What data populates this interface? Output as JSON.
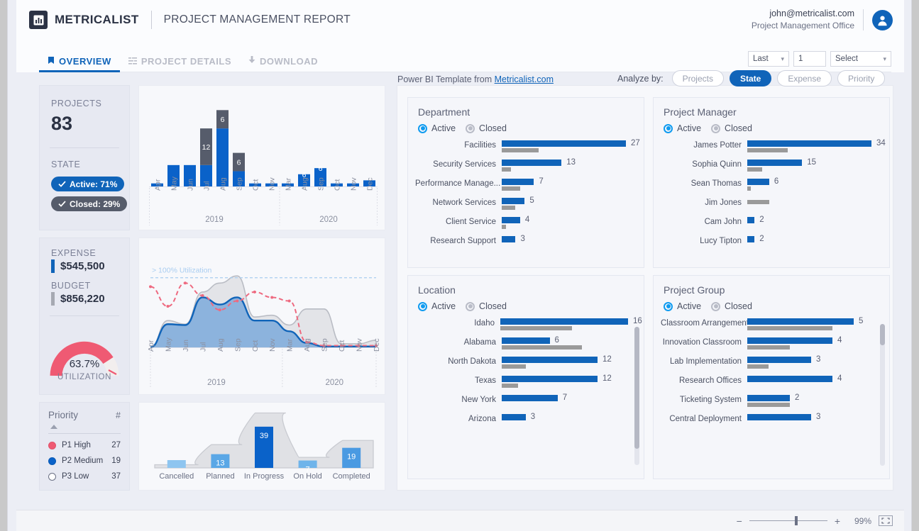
{
  "header": {
    "brand": "METRICALIST",
    "report_title": "PROJECT MANAGEMENT REPORT",
    "user_email": "john@metricalist.com",
    "user_org": "Project Management Office",
    "avatar_icon": "user-avatar-icon",
    "logo_icon": "bar-chart-logo-icon"
  },
  "tabs": [
    {
      "label": "OVERVIEW",
      "icon": "bookmark-icon",
      "active": true
    },
    {
      "label": "PROJECT DETAILS",
      "icon": "list-icon",
      "active": false
    },
    {
      "label": "DOWNLOAD",
      "icon": "download-arrow-icon",
      "active": false
    }
  ],
  "filters": {
    "range_value": "Last",
    "count_value": "1",
    "select_value": "Select",
    "chevron_icon": "chevron-down-icon"
  },
  "kpi": {
    "projects_label": "PROJECTS",
    "projects_value": "83",
    "state_label": "STATE",
    "state_active": "Active: 71%",
    "state_closed": "Closed: 29%",
    "check_icon": "check-icon",
    "expense_label": "EXPENSE",
    "expense_value": "$545,500",
    "budget_label": "BUDGET",
    "budget_value": "$856,220",
    "gauge_value": "63.7%",
    "gauge_label": "UTILIZATION",
    "gauge_percent": 63.7
  },
  "priority": {
    "col_label": "Priority",
    "col_count": "#",
    "sort_icon": "sort-ascending-icon",
    "rows": [
      {
        "label": "P1 High",
        "count": "27",
        "color": "#ef5a73"
      },
      {
        "label": "P2 Medium",
        "count": "19",
        "color": "#0a62c9"
      },
      {
        "label": "P3 Low",
        "count": "37",
        "color": "#ffffff"
      }
    ]
  },
  "toolbar": {
    "pbi_prefix": "Power BI Template from ",
    "pbi_link": "Metricalist.com",
    "analyze_label": "Analyze by:",
    "chips": [
      {
        "label": "Projects",
        "on": false
      },
      {
        "label": "State",
        "on": true
      },
      {
        "label": "Expense",
        "on": false
      },
      {
        "label": "Priority",
        "on": false
      }
    ]
  },
  "colors": {
    "accent_blue": "#1064b9",
    "closed_gray": "#565c6b",
    "bar_gray": "#9a9a9a",
    "gauge_red": "#ef5a73",
    "light_blue": "#8ec5f0"
  },
  "chart_data": [
    {
      "type": "bar",
      "id": "timeline-bar-chart",
      "title": "",
      "xlabel": "",
      "ylabel": "",
      "stacked": true,
      "categories": [
        "Apr",
        "May",
        "Jun",
        "Jul",
        "Aug",
        "Sep",
        "Oct",
        "Nov",
        "Mar",
        "Aug",
        "Sep",
        "Oct",
        "Nov",
        "Dec"
      ],
      "group_labels": [
        "2019",
        "2020"
      ],
      "group_spans": [
        8,
        6
      ],
      "series": [
        {
          "name": "Active",
          "color": "#0a62c9",
          "values": [
            1,
            7,
            7,
            7,
            19,
            5,
            1,
            1,
            1,
            4,
            6,
            1,
            1,
            2
          ]
        },
        {
          "name": "Closed",
          "color": "#565c6b",
          "values": [
            0,
            0,
            0,
            12,
            6,
            6,
            0,
            0,
            0,
            0,
            0,
            0,
            0,
            0
          ]
        }
      ],
      "data_labels": [
        {
          "category": "Jul",
          "value": "12"
        },
        {
          "category": "Aug",
          "value": "6"
        },
        {
          "category": "Sep",
          "value": "6"
        }
      ],
      "ylim": [
        0,
        26
      ]
    },
    {
      "type": "area",
      "id": "utilization-area-chart",
      "title": "",
      "annotation": "> 100% Utilization",
      "categories": [
        "Apr",
        "May",
        "Jun",
        "Jul",
        "Aug",
        "Sep",
        "Oct",
        "Nov",
        "Mar",
        "Aug",
        "Sep",
        "Oct",
        "Nov",
        "Dec"
      ],
      "group_labels": [
        "2019",
        "2020"
      ],
      "group_spans": [
        8,
        6
      ],
      "series": [
        {
          "name": "Budget",
          "color": "#d7d9dd",
          "type": "area",
          "values": [
            0,
            30,
            26,
            62,
            72,
            80,
            34,
            36,
            25,
            43,
            43,
            4,
            4,
            8
          ]
        },
        {
          "name": "Expense",
          "color": "#6fa8dc",
          "type": "area",
          "values": [
            0,
            26,
            25,
            56,
            48,
            56,
            30,
            30,
            18,
            5,
            1,
            1,
            1,
            1
          ]
        },
        {
          "name": "Utilization",
          "color": "#ee6a80",
          "type": "dashed-line",
          "values": [
            68,
            46,
            72,
            58,
            42,
            52,
            62,
            56,
            52,
            6,
            2,
            2,
            2,
            2
          ]
        }
      ],
      "reference_line": {
        "label": "> 100% Utilization",
        "color": "#a9cdf0"
      },
      "ylim": [
        0,
        100
      ]
    },
    {
      "type": "bar",
      "id": "project-status-chart",
      "categories": [
        "Cancelled",
        "Planned",
        "In Progress",
        "On Hold",
        "Completed"
      ],
      "values": [
        0,
        13,
        39,
        7,
        19
      ],
      "labels": [
        "",
        "13",
        "39",
        "7",
        "19"
      ],
      "bar_colors": [
        "#8ec5f0",
        "#5aa7e6",
        "#0a62c9",
        "#6fb4ea",
        "#4a9ae2"
      ],
      "background_series": {
        "name": "envelope",
        "color": "#dddfe3",
        "values": [
          3,
          22,
          52,
          10,
          26
        ]
      },
      "ylim": [
        0,
        55
      ]
    },
    {
      "type": "bar",
      "id": "department-chart",
      "title": "Department",
      "orientation": "horizontal",
      "legend": [
        {
          "label": "Active",
          "on": true
        },
        {
          "label": "Closed",
          "on": false
        }
      ],
      "categories": [
        "Facilities",
        "Security Services",
        "Performance Manage...",
        "Network Services",
        "Client Service",
        "Research Support"
      ],
      "series": [
        {
          "name": "Active",
          "color": "#1064b9",
          "values": [
            27,
            13,
            7,
            5,
            4,
            3
          ]
        },
        {
          "name": "Closed",
          "color": "#9a9a9a",
          "values": [
            8,
            2,
            4,
            3,
            1,
            0
          ]
        }
      ],
      "max_value": 27
    },
    {
      "type": "bar",
      "id": "project-manager-chart",
      "title": "Project Manager",
      "orientation": "horizontal",
      "legend": [
        {
          "label": "Active",
          "on": true
        },
        {
          "label": "Closed",
          "on": false
        }
      ],
      "categories": [
        "James Potter",
        "Sophia Quinn",
        "Sean Thomas",
        "Jim Jones",
        "Cam John",
        "Lucy Tipton"
      ],
      "series": [
        {
          "name": "Active",
          "color": "#1064b9",
          "values": [
            34,
            15,
            6,
            0,
            2,
            2
          ]
        },
        {
          "name": "Closed",
          "color": "#9a9a9a",
          "values": [
            11,
            4,
            1,
            6,
            0,
            0
          ]
        }
      ],
      "max_value": 34
    },
    {
      "type": "bar",
      "id": "location-chart",
      "title": "Location",
      "orientation": "horizontal",
      "scrollable": true,
      "legend": [
        {
          "label": "Active",
          "on": true
        },
        {
          "label": "Closed",
          "on": false
        }
      ],
      "categories": [
        "Idaho",
        "Alabama",
        "North Dakota",
        "Texas",
        "New York",
        "Arizona"
      ],
      "series": [
        {
          "name": "Active",
          "color": "#1064b9",
          "values": [
            16,
            6,
            12,
            12,
            7,
            3
          ]
        },
        {
          "name": "Closed",
          "color": "#9a9a9a",
          "values": [
            9,
            10,
            3,
            2,
            0,
            0
          ]
        }
      ],
      "max_value": 16
    },
    {
      "type": "bar",
      "id": "project-group-chart",
      "title": "Project Group",
      "orientation": "horizontal",
      "scrollable": true,
      "legend": [
        {
          "label": "Active",
          "on": true
        },
        {
          "label": "Closed",
          "on": false
        }
      ],
      "categories": [
        "Classroom Arrangement",
        "Innovation Classroom",
        "Lab Implementation",
        "Research Offices",
        "Ticketing System",
        "Central Deployment"
      ],
      "series": [
        {
          "name": "Active",
          "color": "#1064b9",
          "values": [
            5,
            4,
            3,
            4,
            2,
            3
          ]
        },
        {
          "name": "Closed",
          "color": "#9a9a9a",
          "values": [
            4,
            2,
            1,
            0,
            2,
            0
          ]
        }
      ],
      "max_value": 5
    }
  ],
  "footer": {
    "zoom_out_icon": "minus-icon",
    "zoom_in_icon": "plus-icon",
    "zoom_value": "99%",
    "fit_icon": "fit-to-page-icon"
  }
}
